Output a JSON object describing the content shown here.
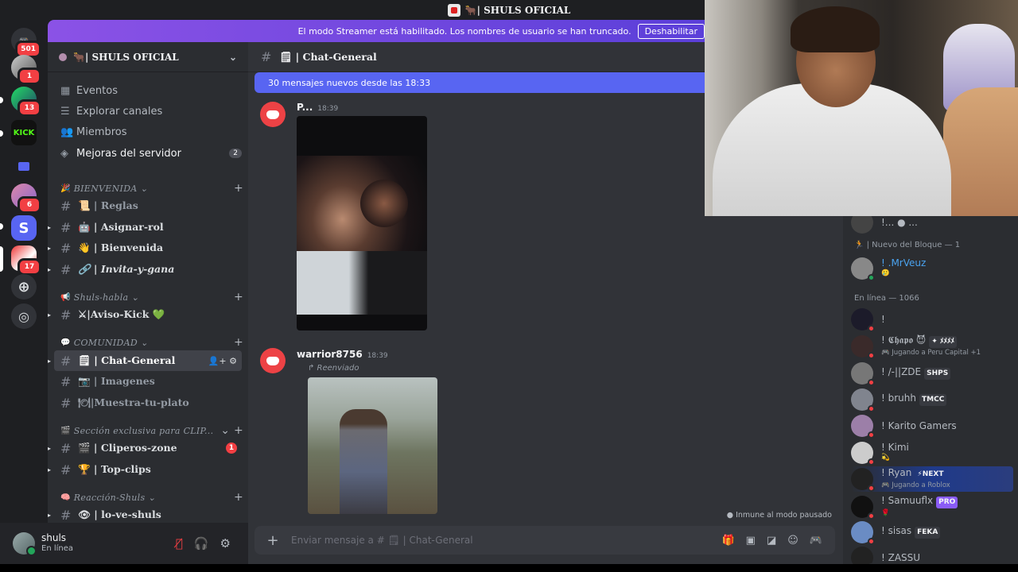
{
  "topbar": {
    "server_title": "🐂| SHULS OFICIAL"
  },
  "banner": {
    "text": "El modo Streamer está habilitado. Los nombres de usuario se han truncado.",
    "button": "Deshabilitar"
  },
  "rail": {
    "badges": [
      "501",
      "1",
      "13",
      "6",
      "17"
    ],
    "kick_label": "KICK",
    "s_label": "S"
  },
  "server": {
    "name": "🐂| SHULS OFICIAL"
  },
  "nav": [
    {
      "icon": "calendar-icon",
      "label": "Eventos"
    },
    {
      "icon": "channels-icon",
      "label": "Explorar canales"
    },
    {
      "icon": "members-icon",
      "label": "Miembros"
    },
    {
      "icon": "boost-icon",
      "label": "Mejoras del servidor",
      "count": "2"
    }
  ],
  "categories": {
    "bienvenida": "BIENVENIDA",
    "shuls_habla": "Shuls-habla",
    "comunidad": "COMUNIDAD",
    "clip": "Sección exclusiva para CLIP...",
    "reaccion": "Reacción-Shuls"
  },
  "channels": {
    "reglas": "📜 | Reglas",
    "asignar": "🤖 | Asignar-rol",
    "bienvenida": "👋 | Bienvenida",
    "invita": "🔗 | Invita-y-gana",
    "aviso": "⚔|Aviso-Kick 💚",
    "chat": "🗒 | Chat-General",
    "imagenes": "📷 | Imagenes",
    "plato": "🍽|Muestra-tu-plato",
    "cliperos": "🎬 | Cliperos-zone",
    "cliperos_badge": "1",
    "topclips": "🏆 | Top-clips",
    "loveshuls": "👁 | lo-ve-shuls"
  },
  "user": {
    "name": "shuls",
    "status": "En línea"
  },
  "chat": {
    "channel": "🗒 | Chat-General",
    "new_messages": "30 mensajes nuevos desde las 18:33",
    "msg1": {
      "author": "P...",
      "time": "18:39"
    },
    "msg2": {
      "author": "warrior8756",
      "time": "18:39",
      "forwarded": "↱ Reenviado"
    },
    "paused": "Inmune al modo pausado",
    "composer_placeholder": "Enviar mensaje a # 🗒 | Chat-General"
  },
  "members": {
    "top_partial": "!... ● ...",
    "section_bloque": "🏃 | Nuevo del Bloque — 1",
    "mrveuz": "! .MrVeuz",
    "mrveuz_emoji": "🥲",
    "section_online": "En línea — 1066",
    "list": [
      {
        "name": "!",
        "tag": "",
        "sub": ""
      },
      {
        "name": "! 𝕮𝖍𝖆𝖕𝖔 😈",
        "tag": "✦ ﾒﾒﾒﾒ",
        "sub": "🎮 Jugando a Peru Capital +1"
      },
      {
        "name": "! /-||ZDE",
        "tag": "SHPS",
        "sub": ""
      },
      {
        "name": "! bruhh",
        "tag": "TMCC",
        "sub": ""
      },
      {
        "name": "! Karito Gamers",
        "tag": "",
        "sub": ""
      },
      {
        "name": "! Kimi",
        "tag": "",
        "sub": "💫"
      },
      {
        "name": "! Ryan",
        "tag": "⚡NEXT",
        "sub": "🎮 Jugando a Roblox"
      },
      {
        "name": "! Samuuflx",
        "tag": "PRO",
        "sub": "🌹"
      },
      {
        "name": "! sisas",
        "tag": "FEKA",
        "sub": ""
      },
      {
        "name": "! ZASSU",
        "tag": "",
        "sub": ""
      }
    ]
  }
}
